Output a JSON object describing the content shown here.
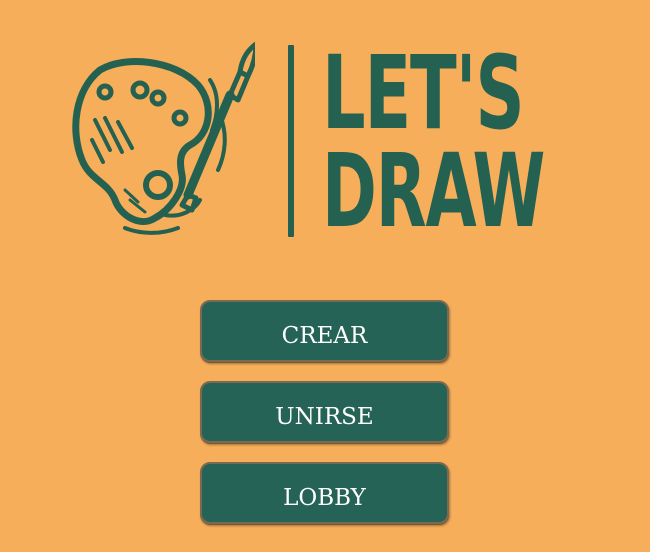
{
  "colors": {
    "background": "#f6ae5a",
    "brand_green": "#256150",
    "button_bg": "#256356",
    "button_text": "#ffffff"
  },
  "logo": {
    "icon": "palette-brush-icon",
    "line1": "LET'S",
    "line2": "DRAW"
  },
  "menu": {
    "create_label": "CREAR",
    "join_label": "UNIRSE",
    "lobby_label": "LOBBY"
  }
}
